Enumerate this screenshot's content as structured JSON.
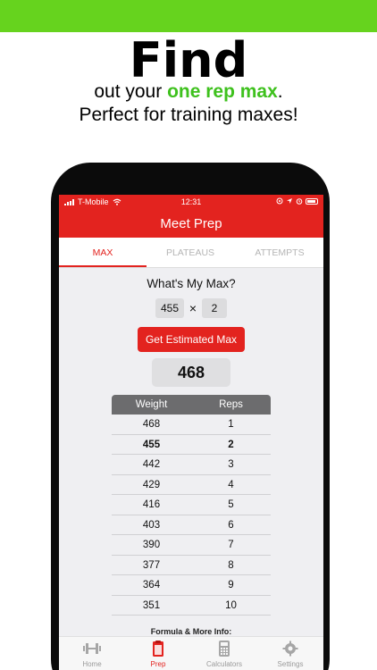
{
  "promo": {
    "headline": "Find",
    "line1_prefix": "out your",
    "line1_accent": "one rep max",
    "line1_suffix": ".",
    "line2": "Perfect for training maxes!",
    "accent_color": "#3ec11d",
    "bar_color": "#66d31e"
  },
  "status_bar": {
    "carrier": "T-Mobile",
    "time": "12:31"
  },
  "nav": {
    "title": "Meet Prep",
    "color": "#e3231f"
  },
  "tabs": [
    {
      "label": "MAX",
      "active": true
    },
    {
      "label": "PLATEAUS",
      "active": false
    },
    {
      "label": "ATTEMPTS",
      "active": false
    }
  ],
  "calculator": {
    "title": "What's My Max?",
    "weight_value": "455",
    "times_symbol": "×",
    "reps_value": "2",
    "button_label": "Get Estimated Max",
    "result": "468"
  },
  "table": {
    "headers": [
      "Weight",
      "Reps"
    ],
    "rows": [
      {
        "weight": "468",
        "reps": "1"
      },
      {
        "weight": "455",
        "reps": "2",
        "highlight": true
      },
      {
        "weight": "442",
        "reps": "3"
      },
      {
        "weight": "429",
        "reps": "4"
      },
      {
        "weight": "416",
        "reps": "5"
      },
      {
        "weight": "403",
        "reps": "6"
      },
      {
        "weight": "390",
        "reps": "7"
      },
      {
        "weight": "377",
        "reps": "8"
      },
      {
        "weight": "364",
        "reps": "9"
      },
      {
        "weight": "351",
        "reps": "10"
      }
    ]
  },
  "footer_note": "Formula & More Info:",
  "tabbar": [
    {
      "label": "Home",
      "icon": "dumbbell-icon",
      "active": false
    },
    {
      "label": "Prep",
      "icon": "clipboard-icon",
      "active": true
    },
    {
      "label": "Calculators",
      "icon": "calculator-icon",
      "active": false
    },
    {
      "label": "Settings",
      "icon": "gear-icon",
      "active": false
    }
  ]
}
